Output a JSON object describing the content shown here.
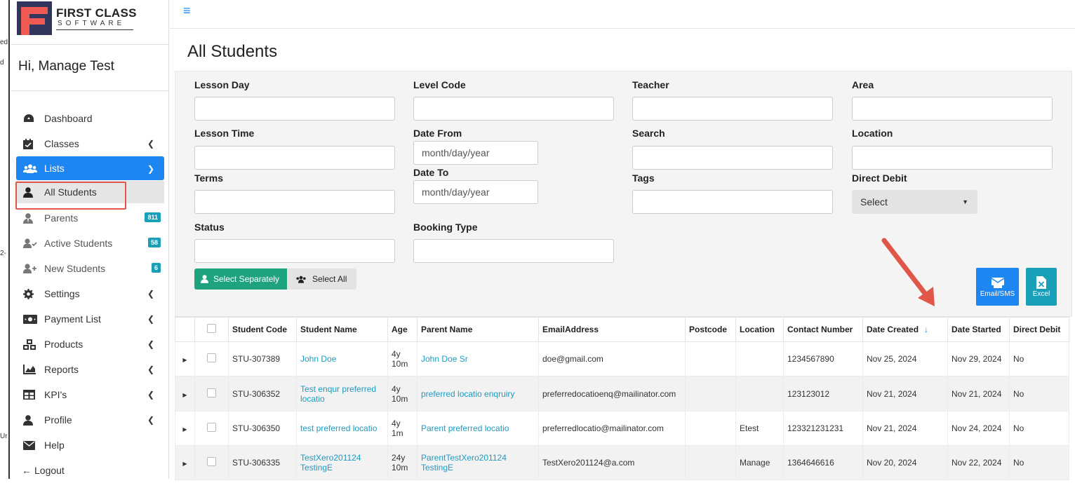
{
  "app": {
    "brand_title": "FIRST CLASS",
    "brand_sub": "SOFTWARE",
    "greeting": "Hi, Manage Test"
  },
  "left_strip": [
    "ed",
    "d",
    "2-",
    "Ur"
  ],
  "sidebar": {
    "items": [
      {
        "label": "Dashboard",
        "icon": "dashboard-icon"
      },
      {
        "label": "Classes",
        "icon": "calendar-check-icon"
      },
      {
        "label": "Lists",
        "icon": "users-icon"
      },
      {
        "label": "All Students",
        "icon": "user-icon"
      },
      {
        "label": "Parents",
        "icon": "user-tie-icon",
        "badge": "811"
      },
      {
        "label": "Active Students",
        "icon": "user-check-icon",
        "badge": "58"
      },
      {
        "label": "New Students",
        "icon": "user-plus-icon",
        "badge": "6"
      },
      {
        "label": "Settings",
        "icon": "gear-icon"
      },
      {
        "label": "Payment List",
        "icon": "money-icon"
      },
      {
        "label": "Products",
        "icon": "cubes-icon"
      },
      {
        "label": "Reports",
        "icon": "area-chart-icon"
      },
      {
        "label": "KPI's",
        "icon": "table-icon"
      },
      {
        "label": "Profile",
        "icon": "user-icon"
      },
      {
        "label": "Help",
        "icon": "envelope-icon"
      },
      {
        "label": "Logout",
        "icon": "arrow-left-icon"
      }
    ]
  },
  "page": {
    "title": "All Students"
  },
  "filters": {
    "lesson_day": "Lesson Day",
    "level_code": "Level Code",
    "teacher": "Teacher",
    "area": "Area",
    "lesson_time": "Lesson Time",
    "date_from": "Date From",
    "date_from_value": "month/day/year",
    "search": "Search",
    "location": "Location",
    "terms": "Terms",
    "date_to": "Date To",
    "date_to_value": "month/day/year",
    "tags": "Tags",
    "direct_debit": "Direct Debit",
    "direct_debit_value": "Select",
    "status": "Status",
    "booking_type": "Booking Type",
    "select_separately": "Select Separately",
    "select_all": "Select All",
    "email_sms": "Email/SMS",
    "excel": "Excel"
  },
  "colors": {
    "primary": "#1e86f0",
    "teal": "#1a9fb8",
    "green": "#1fa37f",
    "annotation": "#e0574a"
  },
  "table": {
    "headers": [
      "Student Code",
      "Student Name",
      "Age",
      "Parent Name",
      "EmailAddress",
      "Postcode",
      "Location",
      "Contact Number",
      "Date Created",
      "Date Started",
      "Direct Debit"
    ],
    "rows": [
      {
        "code": "STU-307389",
        "name1": "John Doe",
        "name2": "",
        "age1": "4y",
        "age2": "10m",
        "parent1": "John Doe Sr",
        "parent2": "",
        "email": "doe@gmail.com",
        "postcode": "",
        "location": "",
        "contact": "1234567890",
        "created": "Nov 25, 2024",
        "started": "Nov 29, 2024",
        "dd": "No"
      },
      {
        "code": "STU-306352",
        "name1": "Test enqur preferred",
        "name2": "locatio",
        "age1": "4y",
        "age2": "10m",
        "parent1": "preferred locatio enqruiry",
        "parent2": "",
        "email": "preferredocatioenq@mailinator.com",
        "postcode": "",
        "location": "",
        "contact": "123123012",
        "created": "Nov 21, 2024",
        "started": "Nov 21, 2024",
        "dd": "No"
      },
      {
        "code": "STU-306350",
        "name1": "test preferred locatio",
        "name2": "",
        "age1": "4y",
        "age2": "1m",
        "parent1": "Parent preferred locatio",
        "parent2": "",
        "email": "preferredlocatio@mailinator.com",
        "postcode": "",
        "location": "Etest",
        "contact": "123321231231",
        "created": "Nov 21, 2024",
        "started": "Nov 24, 2024",
        "dd": "No"
      },
      {
        "code": "STU-306335",
        "name1": "TestXero201124",
        "name2": "TestingE",
        "age1": "24y",
        "age2": "10m",
        "parent1": "ParentTestXero201124",
        "parent2": "TestingE",
        "email": "TestXero201124@a.com",
        "postcode": "",
        "location": "Manage",
        "contact": "1364646616",
        "created": "Nov 20, 2024",
        "started": "Nov 22, 2024",
        "dd": "No"
      }
    ]
  }
}
